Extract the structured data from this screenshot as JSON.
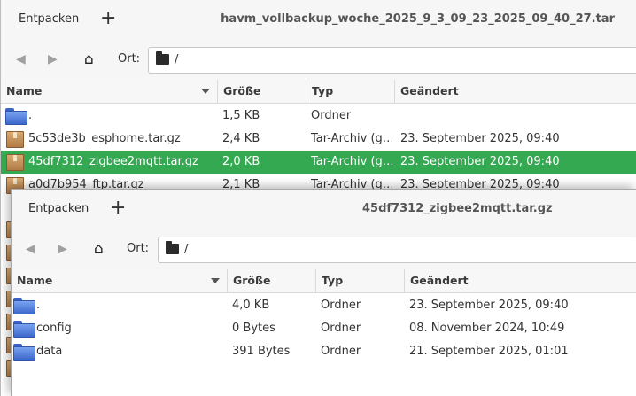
{
  "back_window": {
    "header": {
      "extract_label": "Entpacken",
      "add_icon": "+",
      "title": "havm_vollbackup_woche_2025_9_3_09_23_2025_09_40_27.tar"
    },
    "toolbar": {
      "location_label": "Ort:",
      "path": "/"
    },
    "columns": {
      "name": "Name",
      "size": "Größe",
      "type": "Typ",
      "modified": "Geändert"
    },
    "rows": [
      {
        "name": ".",
        "size": "1,5 KB",
        "type": "Ordner",
        "modified": "",
        "icon": "folder"
      },
      {
        "name": "5c53de3b_esphome.tar.gz",
        "size": "2,4 KB",
        "type": "Tar-Archiv (g…",
        "modified": "23. September 2025, 09:40",
        "icon": "archive"
      },
      {
        "name": "45df7312_zigbee2mqtt.tar.gz",
        "size": "2,0 KB",
        "type": "Tar-Archiv (g…",
        "modified": "23. September 2025, 09:40",
        "icon": "archive",
        "selected": true
      },
      {
        "name": "a0d7b954_ftp.tar.gz",
        "size": "2,1 KB",
        "type": "Tar-Archiv (g…",
        "modified": "23. September 2025, 09:40",
        "icon": "archive"
      }
    ]
  },
  "front_window": {
    "header": {
      "extract_label": "Entpacken",
      "add_icon": "+",
      "title": "45df7312_zigbee2mqtt.tar.gz"
    },
    "toolbar": {
      "location_label": "Ort:",
      "path": "/"
    },
    "columns": {
      "name": "Name",
      "size": "Größe",
      "type": "Typ",
      "modified": "Geändert"
    },
    "rows": [
      {
        "name": ".",
        "size": "4,0 KB",
        "type": "Ordner",
        "modified": "23. September 2025, 09:40",
        "icon": "folder"
      },
      {
        "name": "config",
        "size": "0 Bytes",
        "type": "Ordner",
        "modified": "08. November 2024, 10:49",
        "icon": "folder"
      },
      {
        "name": "data",
        "size": "391 Bytes",
        "type": "Ordner",
        "modified": "21. September 2025, 01:01",
        "icon": "folder"
      }
    ]
  },
  "colors": {
    "selection": "#35a852",
    "folder": "#4a78d8",
    "archive": "#c4915a"
  }
}
